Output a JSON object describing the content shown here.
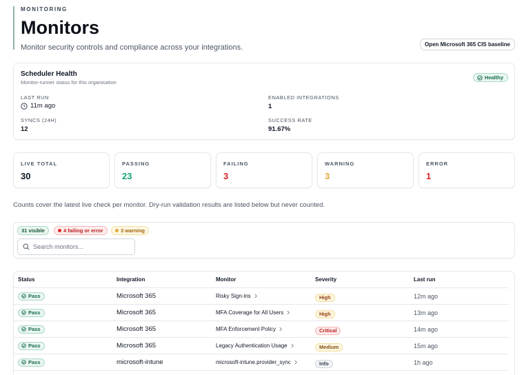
{
  "header": {
    "eyebrow": "MONITORING",
    "title": "Monitors",
    "subtitle": "Monitor security controls and compliance across your integrations.",
    "cis_button": "Open Microsoft 365 CIS baseline"
  },
  "scheduler": {
    "title": "Scheduler Health",
    "subtitle": "Monitor-runner status for this organisation",
    "status": "Healthy",
    "last_run_label": "LAST RUN",
    "last_run_value": "11m ago",
    "enabled_label": "ENABLED INTEGRATIONS",
    "enabled_value": "1",
    "syncs_label": "SYNCS (24H)",
    "syncs_value": "12",
    "success_label": "SUCCESS RATE",
    "success_value": "91.67%"
  },
  "metrics": [
    {
      "label": "LIVE TOTAL",
      "value": "30",
      "color": "#111827"
    },
    {
      "label": "PASSING",
      "value": "23",
      "color": "#16a37a"
    },
    {
      "label": "FAILING",
      "value": "3",
      "color": "#dc2626"
    },
    {
      "label": "WARNING",
      "value": "3",
      "color": "#e2a93b"
    },
    {
      "label": "ERROR",
      "value": "1",
      "color": "#dc2626"
    }
  ],
  "note": "Counts cover the latest live check per monitor. Dry-run validation results are listed below but never counted.",
  "filters": {
    "visible": "31 visible",
    "failing": "4 failing or error",
    "warning": "3 warning",
    "search_placeholder": "Search monitors..."
  },
  "table": {
    "headers": [
      "Status",
      "Integration",
      "Monitor",
      "Severity",
      "Last run"
    ],
    "rows": [
      {
        "status": "Pass",
        "integration": "Microsoft 365",
        "monitor": "Risky Sign-ins",
        "severity": "High",
        "last_run": "12m ago"
      },
      {
        "status": "Pass",
        "integration": "Microsoft 365",
        "monitor": "MFA Coverage for All Users",
        "severity": "High",
        "last_run": "13m ago"
      },
      {
        "status": "Pass",
        "integration": "Microsoft 365",
        "monitor": "MFA Enforcement Policy",
        "severity": "Critical",
        "last_run": "14m ago"
      },
      {
        "status": "Pass",
        "integration": "Microsoft 365",
        "monitor": "Legacy Authentication Usage",
        "severity": "Medium",
        "last_run": "15m ago"
      },
      {
        "status": "Pass",
        "integration": "microsoft-intune",
        "monitor": "microsoft-intune.provider_sync",
        "severity": "Info",
        "last_run": "1h ago"
      }
    ]
  },
  "severity_colors": {
    "High": {
      "bg": "#fdf4dc",
      "border": "#f3dfa0",
      "text": "#92400e"
    },
    "Critical": {
      "bg": "#fdecec",
      "border": "#f5b5b5",
      "text": "#b91c1c"
    },
    "Medium": {
      "bg": "#fdf6e3",
      "border": "#f3dfa0",
      "text": "#854d0e"
    },
    "Info": {
      "bg": "#f3f4f6",
      "border": "#d1d5db",
      "text": "#374151"
    }
  }
}
